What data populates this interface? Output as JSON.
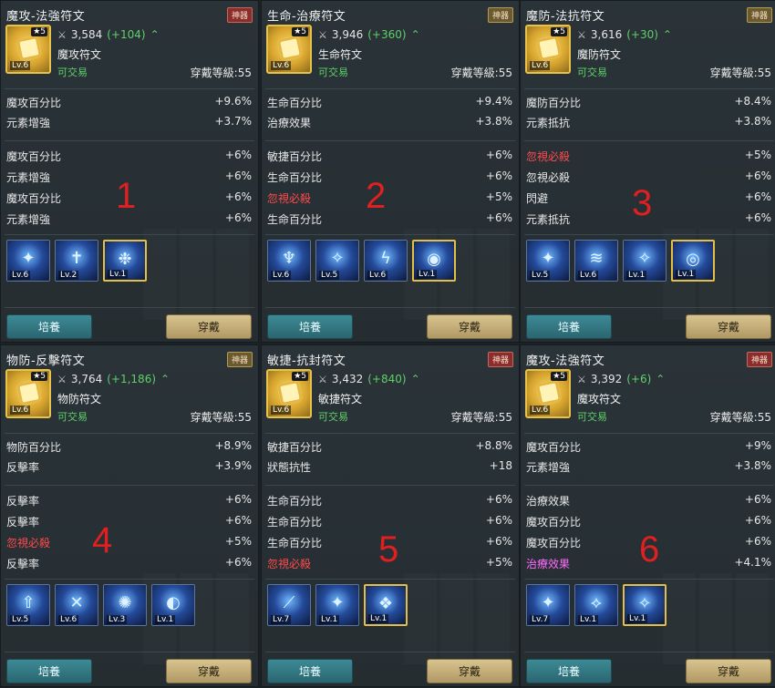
{
  "panels": [
    {
      "title": "魔攻-法強符文",
      "tag": "神器",
      "tag_style": "red",
      "star": "★5",
      "level": "Lv.6",
      "power": "3,584",
      "delta": "(+104)",
      "type": "魔攻符文",
      "tradable": "可交易",
      "wear_level": "穿戴等級:55",
      "main_stats": [
        {
          "name": "魔攻百分比",
          "value": "+9.6%"
        },
        {
          "name": "元素增強",
          "value": "+3.7%"
        }
      ],
      "sub_stats": [
        {
          "name": "魔攻百分比",
          "value": "+6%",
          "color": "normal"
        },
        {
          "name": "元素增強",
          "value": "+6%",
          "color": "normal"
        },
        {
          "name": "魔攻百分比",
          "value": "+6%",
          "color": "normal"
        },
        {
          "name": "元素增強",
          "value": "+6%",
          "color": "normal"
        }
      ],
      "number": "1",
      "skills": [
        {
          "lv": "Lv.6",
          "glyph": "✦",
          "gold": false
        },
        {
          "lv": "Lv.2",
          "glyph": "✝",
          "gold": false
        },
        {
          "lv": "Lv.1",
          "glyph": "❉",
          "gold": true
        }
      ],
      "cultivate": "培養",
      "wear": "穿戴"
    },
    {
      "title": "生命-治療符文",
      "tag": "神器",
      "tag_style": "gold",
      "star": "★5",
      "level": "Lv.6",
      "power": "3,946",
      "delta": "(+360)",
      "type": "生命符文",
      "tradable": "可交易",
      "wear_level": "穿戴等級:55",
      "main_stats": [
        {
          "name": "生命百分比",
          "value": "+9.4%"
        },
        {
          "name": "治療效果",
          "value": "+3.8%"
        }
      ],
      "sub_stats": [
        {
          "name": "敏捷百分比",
          "value": "+6%",
          "color": "normal"
        },
        {
          "name": "生命百分比",
          "value": "+6%",
          "color": "normal"
        },
        {
          "name": "忽視必殺",
          "value": "+5%",
          "color": "red"
        },
        {
          "name": "生命百分比",
          "value": "+6%",
          "color": "normal"
        }
      ],
      "number": "2",
      "skills": [
        {
          "lv": "Lv.6",
          "glyph": "♆",
          "gold": false
        },
        {
          "lv": "Lv.5",
          "glyph": "✧",
          "gold": false
        },
        {
          "lv": "Lv.6",
          "glyph": "ϟ",
          "gold": false
        },
        {
          "lv": "Lv.1",
          "glyph": "◉",
          "gold": true
        }
      ],
      "cultivate": "培養",
      "wear": "穿戴"
    },
    {
      "title": "魔防-法抗符文",
      "tag": "神器",
      "tag_style": "gold",
      "star": "★5",
      "level": "Lv.6",
      "power": "3,616",
      "delta": "(+30)",
      "type": "魔防符文",
      "tradable": "可交易",
      "wear_level": "穿戴等級:55",
      "main_stats": [
        {
          "name": "魔防百分比",
          "value": "+8.4%"
        },
        {
          "name": "元素抵抗",
          "value": "+3.8%"
        }
      ],
      "sub_stats": [
        {
          "name": "忽視必殺",
          "value": "+5%",
          "color": "red"
        },
        {
          "name": "忽視必殺",
          "value": "+6%",
          "color": "normal"
        },
        {
          "name": "閃避",
          "value": "+6%",
          "color": "normal"
        },
        {
          "name": "元素抵抗",
          "value": "+6%",
          "color": "normal"
        }
      ],
      "number": "3",
      "skills": [
        {
          "lv": "Lv.5",
          "glyph": "✦",
          "gold": false
        },
        {
          "lv": "Lv.6",
          "glyph": "≋",
          "gold": false
        },
        {
          "lv": "Lv.1",
          "glyph": "✧",
          "gold": false
        },
        {
          "lv": "Lv.1",
          "glyph": "◎",
          "gold": true
        }
      ],
      "cultivate": "培養",
      "wear": "穿戴"
    },
    {
      "title": "物防-反擊符文",
      "tag": "神器",
      "tag_style": "gold",
      "star": "★5",
      "level": "Lv.6",
      "power": "3,764",
      "delta": "(+1,186)",
      "type": "物防符文",
      "tradable": "可交易",
      "wear_level": "穿戴等級:55",
      "main_stats": [
        {
          "name": "物防百分比",
          "value": "+8.9%"
        },
        {
          "name": "反擊率",
          "value": "+3.9%"
        }
      ],
      "sub_stats": [
        {
          "name": "反擊率",
          "value": "+6%",
          "color": "normal"
        },
        {
          "name": "反擊率",
          "value": "+6%",
          "color": "normal"
        },
        {
          "name": "忽視必殺",
          "value": "+5%",
          "color": "red"
        },
        {
          "name": "反擊率",
          "value": "+6%",
          "color": "normal"
        }
      ],
      "number": "4",
      "skills": [
        {
          "lv": "Lv.5",
          "glyph": "⇧",
          "gold": false
        },
        {
          "lv": "Lv.6",
          "glyph": "✕",
          "gold": false
        },
        {
          "lv": "Lv.3",
          "glyph": "✺",
          "gold": false
        },
        {
          "lv": "Lv.1",
          "glyph": "◐",
          "gold": false
        }
      ],
      "cultivate": "培養",
      "wear": "穿戴"
    },
    {
      "title": "敏捷-抗封符文",
      "tag": "神器",
      "tag_style": "red",
      "star": "★5",
      "level": "Lv.6",
      "power": "3,432",
      "delta": "(+840)",
      "type": "敏捷符文",
      "tradable": "可交易",
      "wear_level": "穿戴等級:55",
      "main_stats": [
        {
          "name": "敏捷百分比",
          "value": "+8.8%"
        },
        {
          "name": "狀態抗性",
          "value": "+18"
        }
      ],
      "sub_stats": [
        {
          "name": "生命百分比",
          "value": "+6%",
          "color": "normal"
        },
        {
          "name": "生命百分比",
          "value": "+6%",
          "color": "normal"
        },
        {
          "name": "生命百分比",
          "value": "+6%",
          "color": "normal"
        },
        {
          "name": "忽視必殺",
          "value": "+5%",
          "color": "red"
        }
      ],
      "number": "5",
      "skills": [
        {
          "lv": "Lv.7",
          "glyph": "⟋",
          "gold": false
        },
        {
          "lv": "Lv.1",
          "glyph": "✦",
          "gold": false
        },
        {
          "lv": "Lv.1",
          "glyph": "❖",
          "gold": true
        }
      ],
      "cultivate": "培養",
      "wear": "穿戴"
    },
    {
      "title": "魔攻-法強符文",
      "tag": "神器",
      "tag_style": "red",
      "star": "★5",
      "level": "Lv.6",
      "power": "3,392",
      "delta": "(+6)",
      "type": "魔攻符文",
      "tradable": "可交易",
      "wear_level": "穿戴等級:55",
      "main_stats": [
        {
          "name": "魔攻百分比",
          "value": "+9%"
        },
        {
          "name": "元素增強",
          "value": "+3.8%"
        }
      ],
      "sub_stats": [
        {
          "name": "治療效果",
          "value": "+6%",
          "color": "normal"
        },
        {
          "name": "魔攻百分比",
          "value": "+6%",
          "color": "normal"
        },
        {
          "name": "魔攻百分比",
          "value": "+6%",
          "color": "normal"
        },
        {
          "name": "治療效果",
          "value": "+4.1%",
          "color": "pink"
        }
      ],
      "number": "6",
      "skills": [
        {
          "lv": "Lv.7",
          "glyph": "✦",
          "gold": false
        },
        {
          "lv": "Lv.1",
          "glyph": "⟡",
          "gold": false
        },
        {
          "lv": "Lv.1",
          "glyph": "✧",
          "gold": true
        }
      ],
      "cultivate": "培養",
      "wear": "穿戴"
    }
  ]
}
